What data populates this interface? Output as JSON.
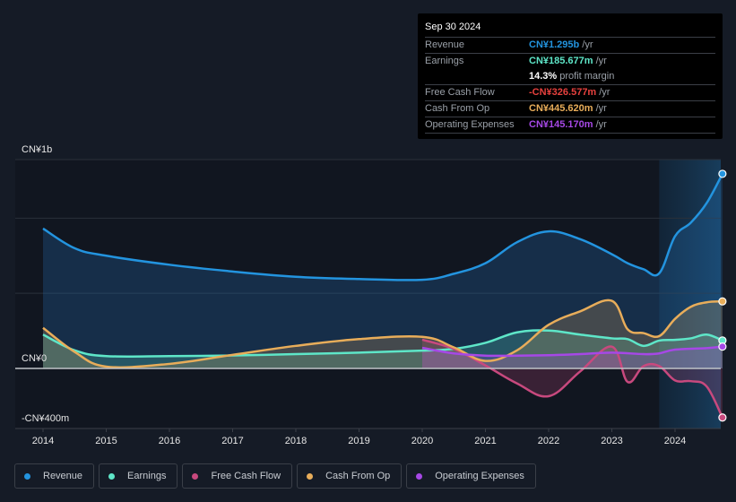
{
  "tooltip": {
    "date": "Sep 30 2024",
    "rows": [
      {
        "label": "Revenue",
        "value": "CN¥1.295b",
        "unit": "/yr",
        "color": "#2394df"
      },
      {
        "label": "Earnings",
        "value": "CN¥185.677m",
        "unit": "/yr",
        "color": "#5ee6c8"
      },
      {
        "label": "",
        "value": "14.3%",
        "unit": "profit margin",
        "color": "#ffffff"
      },
      {
        "label": "Free Cash Flow",
        "value": "-CN¥326.577m",
        "unit": "/yr",
        "color": "#e8413e"
      },
      {
        "label": "Cash From Op",
        "value": "CN¥445.620m",
        "unit": "/yr",
        "color": "#e8ad5a"
      },
      {
        "label": "Operating Expenses",
        "value": "CN¥145.170m",
        "unit": "/yr",
        "color": "#a648e6"
      }
    ]
  },
  "legend": [
    {
      "label": "Revenue",
      "color": "#2394df"
    },
    {
      "label": "Earnings",
      "color": "#5ee6c8"
    },
    {
      "label": "Free Cash Flow",
      "color": "#c8497e"
    },
    {
      "label": "Cash From Op",
      "color": "#e8ad5a"
    },
    {
      "label": "Operating Expenses",
      "color": "#a648e6"
    }
  ],
  "chart_data": {
    "type": "area",
    "title": "",
    "currency": "CN¥",
    "unit": "millions",
    "y_labels": [
      {
        "value": 1000,
        "text": "CN¥1b"
      },
      {
        "value": 0,
        "text": "CN¥0"
      },
      {
        "value": -400,
        "text": "-CN¥400m"
      }
    ],
    "ylim": [
      -400,
      1390
    ],
    "xlim": [
      2013.5,
      2024.75
    ],
    "x_ticks": [
      2014,
      2015,
      2016,
      2017,
      2018,
      2019,
      2020,
      2021,
      2022,
      2023,
      2024
    ],
    "highlight_from": 2023.75,
    "grid": true,
    "legend_position": "bottom",
    "series": [
      {
        "name": "Revenue",
        "color": "#2394df",
        "points": [
          [
            2014.0,
            931
          ],
          [
            2014.5,
            800
          ],
          [
            2015.0,
            750
          ],
          [
            2016.0,
            690
          ],
          [
            2017.0,
            645
          ],
          [
            2018.0,
            610
          ],
          [
            2019.0,
            595
          ],
          [
            2020.0,
            590
          ],
          [
            2020.5,
            630
          ],
          [
            2021.0,
            700
          ],
          [
            2021.5,
            840
          ],
          [
            2022.0,
            912
          ],
          [
            2022.5,
            860
          ],
          [
            2023.0,
            760
          ],
          [
            2023.25,
            700
          ],
          [
            2023.5,
            660
          ],
          [
            2023.75,
            633
          ],
          [
            2024.0,
            880
          ],
          [
            2024.25,
            970
          ],
          [
            2024.5,
            1100
          ],
          [
            2024.75,
            1295
          ]
        ]
      },
      {
        "name": "Earnings",
        "color": "#5ee6c8",
        "points": [
          [
            2014.0,
            225
          ],
          [
            2014.5,
            120
          ],
          [
            2015.0,
            82
          ],
          [
            2016.0,
            82
          ],
          [
            2017.0,
            86
          ],
          [
            2018.0,
            95
          ],
          [
            2019.0,
            105
          ],
          [
            2020.0,
            118
          ],
          [
            2020.5,
            130
          ],
          [
            2021.0,
            170
          ],
          [
            2021.5,
            240
          ],
          [
            2022.0,
            252
          ],
          [
            2022.5,
            225
          ],
          [
            2023.0,
            200
          ],
          [
            2023.25,
            195
          ],
          [
            2023.5,
            150
          ],
          [
            2023.75,
            185
          ],
          [
            2024.0,
            190
          ],
          [
            2024.25,
            200
          ],
          [
            2024.5,
            225
          ],
          [
            2024.75,
            186
          ]
        ]
      },
      {
        "name": "Free Cash Flow",
        "color": "#c8497e",
        "points": [
          [
            2020.0,
            191
          ],
          [
            2020.5,
            130
          ],
          [
            2021.0,
            20
          ],
          [
            2021.5,
            -100
          ],
          [
            2022.0,
            -185
          ],
          [
            2022.5,
            -20
          ],
          [
            2023.0,
            145
          ],
          [
            2023.25,
            -90
          ],
          [
            2023.5,
            15
          ],
          [
            2023.75,
            15
          ],
          [
            2024.0,
            -80
          ],
          [
            2024.25,
            -85
          ],
          [
            2024.5,
            -120
          ],
          [
            2024.75,
            -327
          ]
        ]
      },
      {
        "name": "Cash From Op",
        "color": "#e8ad5a",
        "points": [
          [
            2014.0,
            270
          ],
          [
            2014.5,
            110
          ],
          [
            2015.0,
            12
          ],
          [
            2016.0,
            30
          ],
          [
            2017.0,
            90
          ],
          [
            2018.0,
            150
          ],
          [
            2019.0,
            195
          ],
          [
            2020.0,
            210
          ],
          [
            2020.5,
            140
          ],
          [
            2021.0,
            50
          ],
          [
            2021.5,
            120
          ],
          [
            2022.0,
            290
          ],
          [
            2022.5,
            380
          ],
          [
            2023.0,
            450
          ],
          [
            2023.25,
            260
          ],
          [
            2023.5,
            235
          ],
          [
            2023.75,
            215
          ],
          [
            2024.0,
            330
          ],
          [
            2024.25,
            410
          ],
          [
            2024.5,
            440
          ],
          [
            2024.75,
            446
          ]
        ]
      },
      {
        "name": "Operating Expenses",
        "color": "#a648e6",
        "points": [
          [
            2020.0,
            137
          ],
          [
            2020.5,
            100
          ],
          [
            2021.0,
            85
          ],
          [
            2021.5,
            85
          ],
          [
            2022.0,
            88
          ],
          [
            2022.5,
            95
          ],
          [
            2023.0,
            105
          ],
          [
            2023.5,
            95
          ],
          [
            2023.75,
            100
          ],
          [
            2024.0,
            125
          ],
          [
            2024.5,
            135
          ],
          [
            2024.75,
            145
          ]
        ]
      }
    ]
  }
}
